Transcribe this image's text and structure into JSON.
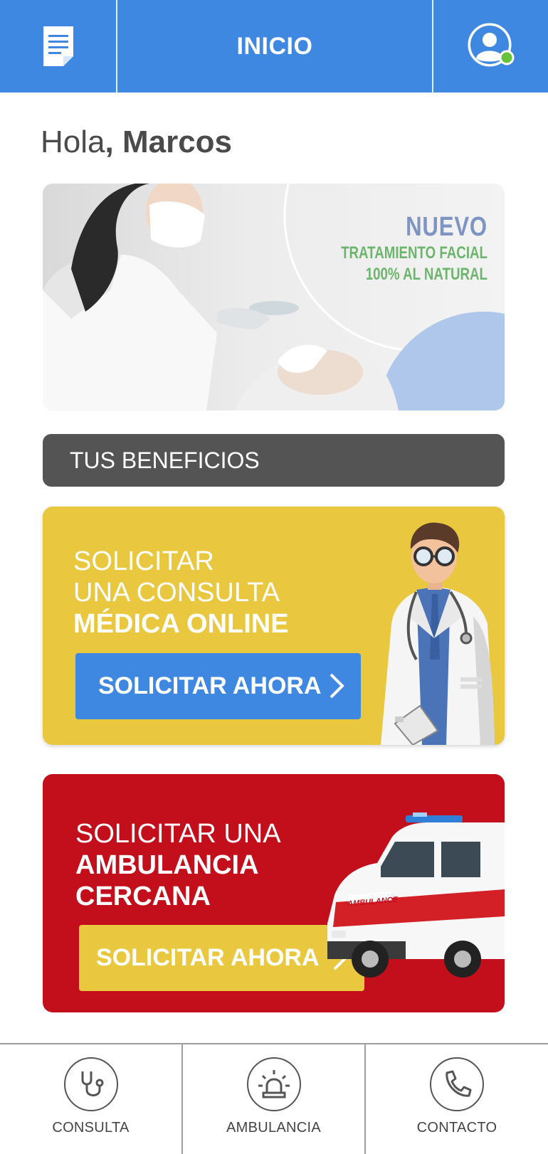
{
  "header": {
    "title": "INICIO",
    "left_icon": "document-icon",
    "right_icon": "user-avatar-icon",
    "status_color": "#67c23a"
  },
  "greeting": {
    "prefix": "Hola",
    "name": ", Marcos"
  },
  "promo": {
    "headline": "NUEVO",
    "line1": "TRATAMIENTO FACIAL",
    "line2": "100% AL NATURAL"
  },
  "section": {
    "title": "TUS BENEFICIOS"
  },
  "cards": [
    {
      "line1": "SOLICITAR",
      "line2": "UNA CONSULTA",
      "line3": "MÉDICA ONLINE",
      "button": "SOLICITAR AHORA",
      "bg_color": "#e9c73f",
      "button_color": "#3f88e2"
    },
    {
      "line1": "SOLICITAR UNA",
      "line2": "AMBULANCIA",
      "line3": "CERCANA",
      "button": "SOLICITAR AHORA",
      "bg_color": "#c30e1b",
      "button_color": "#e9c73f"
    }
  ],
  "bottom_nav": [
    {
      "label": "CONSULTA",
      "icon": "stethoscope-icon"
    },
    {
      "label": "AMBULANCIA",
      "icon": "siren-icon"
    },
    {
      "label": "CONTACTO",
      "icon": "phone-icon"
    }
  ],
  "colors": {
    "primary_blue": "#3f88e2",
    "dark_gray": "#545454",
    "yellow": "#e9c73f",
    "red": "#c30e1b"
  }
}
